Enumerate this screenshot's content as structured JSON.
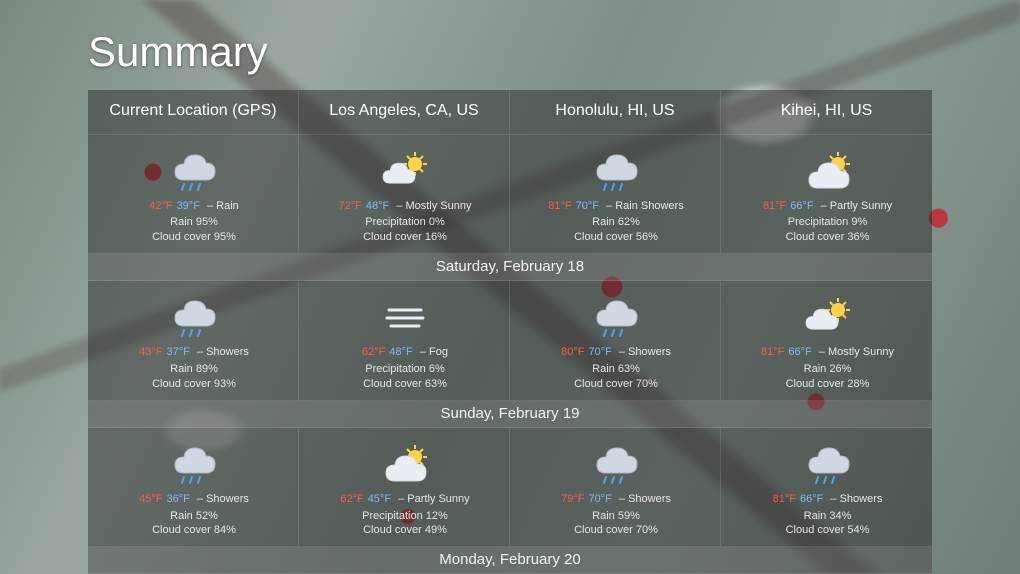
{
  "title": "Summary",
  "locations": [
    {
      "name": "Current Location (GPS)",
      "icon": "rain"
    },
    {
      "name": "Los Angeles, CA, US",
      "icon": "mostly-sunny"
    },
    {
      "name": "Honolulu, HI, US",
      "icon": "rain-showers"
    },
    {
      "name": "Kihei, HI, US",
      "icon": "partly-sunny"
    }
  ],
  "days": [
    {
      "date": "Saturday, February 18",
      "cells": [
        {
          "hi": "42°F",
          "lo": "39°F",
          "cond": "Rain",
          "precip_label": "Rain",
          "precip": "95%",
          "cloud": "95%",
          "icon": "rain"
        },
        {
          "hi": "72°F",
          "lo": "48°F",
          "cond": "Mostly Sunny",
          "precip_label": "Precipitation",
          "precip": "0%",
          "cloud": "16%",
          "icon": "mostly-sunny"
        },
        {
          "hi": "81°F",
          "lo": "70°F",
          "cond": "Rain Showers",
          "precip_label": "Rain",
          "precip": "62%",
          "cloud": "56%",
          "icon": "rain-showers"
        },
        {
          "hi": "81°F",
          "lo": "66°F",
          "cond": "Partly Sunny",
          "precip_label": "Precipitation",
          "precip": "9%",
          "cloud": "36%",
          "icon": "partly-sunny"
        }
      ]
    },
    {
      "date": "Sunday, February 19",
      "cells": [
        {
          "hi": "43°F",
          "lo": "37°F",
          "cond": "Showers",
          "precip_label": "Rain",
          "precip": "89%",
          "cloud": "93%",
          "icon": "showers"
        },
        {
          "hi": "62°F",
          "lo": "48°F",
          "cond": "Fog",
          "precip_label": "Precipitation",
          "precip": "6%",
          "cloud": "63%",
          "icon": "fog"
        },
        {
          "hi": "80°F",
          "lo": "70°F",
          "cond": "Showers",
          "precip_label": "Rain",
          "precip": "63%",
          "cloud": "70%",
          "icon": "showers"
        },
        {
          "hi": "81°F",
          "lo": "66°F",
          "cond": "Mostly Sunny",
          "precip_label": "Rain",
          "precip": "26%",
          "cloud": "28%",
          "icon": "mostly-sunny"
        }
      ]
    },
    {
      "date": "Monday, February 20",
      "cells": [
        {
          "hi": "45°F",
          "lo": "36°F",
          "cond": "Showers",
          "precip_label": "Rain",
          "precip": "52%",
          "cloud": "84%",
          "icon": "showers"
        },
        {
          "hi": "62°F",
          "lo": "45°F",
          "cond": "Partly Sunny",
          "precip_label": "Precipitation",
          "precip": "12%",
          "cloud": "49%",
          "icon": "partly-sunny"
        },
        {
          "hi": "79°F",
          "lo": "70°F",
          "cond": "Showers",
          "precip_label": "Rain",
          "precip": "59%",
          "cloud": "70%",
          "icon": "showers"
        },
        {
          "hi": "81°F",
          "lo": "66°F",
          "cond": "Showers",
          "precip_label": "Rain",
          "precip": "34%",
          "cloud": "54%",
          "icon": "showers"
        }
      ]
    }
  ],
  "labels": {
    "cloud_cover": "Cloud cover",
    "dash": " – "
  }
}
